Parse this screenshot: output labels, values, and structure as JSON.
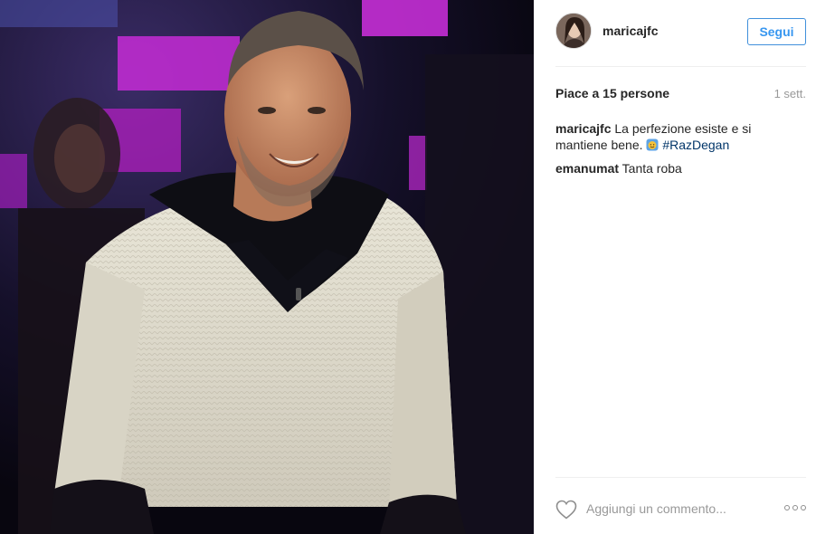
{
  "post": {
    "photo_description_icon": "photo",
    "author": {
      "username": "maricajfc",
      "avatar_icon": "avatar"
    },
    "follow_label": "Segui",
    "likes": "Piace a 15 persone",
    "time": "1 sett.",
    "caption": {
      "username": "maricajfc",
      "text": "La perfezione esiste e si mantiene bene.",
      "emoji_icon": "smiling-emoji-icon",
      "hashtag": "#RazDegan"
    },
    "comments": [
      {
        "username": "emanumat",
        "text": "Tanta roba"
      }
    ],
    "comment_box": {
      "placeholder": "Aggiungi un commento..."
    },
    "colors": {
      "accent": "#3897f0",
      "hashtag": "#003569",
      "muted": "#999999",
      "divider": "#efefef"
    }
  }
}
